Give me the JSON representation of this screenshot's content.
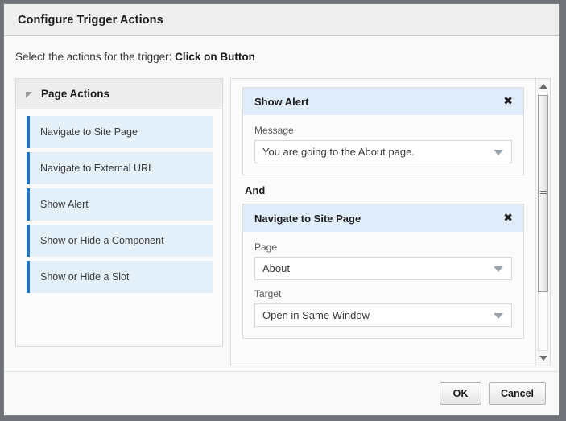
{
  "dialog": {
    "title": "Configure Trigger Actions",
    "instruction_prefix": "Select the actions for the trigger: ",
    "instruction_trigger": "Click on Button"
  },
  "left_panel": {
    "header": {
      "title": "Page Actions",
      "disclosure_icon": "triangle-expanded-icon"
    },
    "items": [
      {
        "label": "Navigate to Site Page"
      },
      {
        "label": "Navigate to External URL"
      },
      {
        "label": "Show Alert"
      },
      {
        "label": "Show or Hide a Component"
      },
      {
        "label": "Show or Hide a Slot"
      }
    ]
  },
  "right_panel": {
    "conjunction": "And",
    "close_icon": "close-icon",
    "dropdown_icon": "chevron-down-icon",
    "cards": [
      {
        "title": "Show Alert",
        "fields": [
          {
            "label": "Message",
            "value": "You are going to the About page."
          }
        ]
      },
      {
        "title": "Navigate to Site Page",
        "fields": [
          {
            "label": "Page",
            "value": "About"
          },
          {
            "label": "Target",
            "value": "Open in Same Window"
          }
        ]
      }
    ],
    "scrollbar": {
      "up_icon": "scroll-up-arrow-icon",
      "down_icon": "scroll-down-arrow-icon",
      "grip_icon": "scroll-thumb-grip-icon"
    }
  },
  "footer": {
    "ok_label": "OK",
    "cancel_label": "Cancel"
  },
  "colors": {
    "accent_blue": "#1f73c0",
    "item_background": "#e3eff9",
    "card_header": "#e0ecfa",
    "dialog_background": "#f9f9f9",
    "outer_background": "#6f7276"
  }
}
